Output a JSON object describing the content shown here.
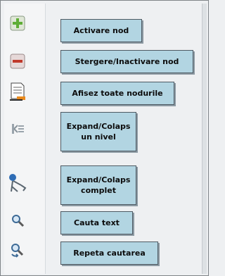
{
  "toolbar": {
    "items": [
      {
        "icon": "plus-icon",
        "label": "Activare nod"
      },
      {
        "icon": "minus-icon",
        "label": "Stergere/Inactivare nod"
      },
      {
        "icon": "document-list-icon",
        "label": "Afisez toate nodurile"
      },
      {
        "icon": "tree-expand-icon",
        "label": "Expand/Colaps\nun nivel"
      },
      {
        "icon": "branch-expand-icon",
        "label": "Expand/Colaps\ncomplet"
      },
      {
        "icon": "magnifier-icon",
        "label": "Cauta text"
      },
      {
        "icon": "search-repeat-icon",
        "label": "Repeta cautarea"
      }
    ]
  },
  "colors": {
    "tooltip_bg": "#b2d5e2",
    "tooltip_border": "#4e5a63",
    "plus_green": "#6cb33e",
    "minus_red": "#c0392b"
  }
}
